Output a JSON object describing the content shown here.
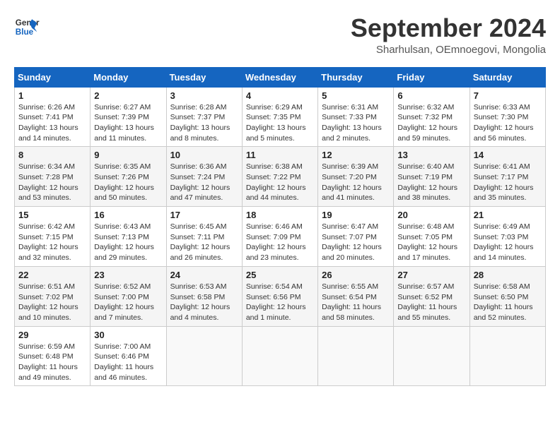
{
  "header": {
    "logo_line1": "General",
    "logo_line2": "Blue",
    "month": "September 2024",
    "location": "Sharhulsan, OEmnoegovi, Mongolia"
  },
  "weekdays": [
    "Sunday",
    "Monday",
    "Tuesday",
    "Wednesday",
    "Thursday",
    "Friday",
    "Saturday"
  ],
  "weeks": [
    [
      {
        "day": "1",
        "info": "Sunrise: 6:26 AM\nSunset: 7:41 PM\nDaylight: 13 hours\nand 14 minutes."
      },
      {
        "day": "2",
        "info": "Sunrise: 6:27 AM\nSunset: 7:39 PM\nDaylight: 13 hours\nand 11 minutes."
      },
      {
        "day": "3",
        "info": "Sunrise: 6:28 AM\nSunset: 7:37 PM\nDaylight: 13 hours\nand 8 minutes."
      },
      {
        "day": "4",
        "info": "Sunrise: 6:29 AM\nSunset: 7:35 PM\nDaylight: 13 hours\nand 5 minutes."
      },
      {
        "day": "5",
        "info": "Sunrise: 6:31 AM\nSunset: 7:33 PM\nDaylight: 13 hours\nand 2 minutes."
      },
      {
        "day": "6",
        "info": "Sunrise: 6:32 AM\nSunset: 7:32 PM\nDaylight: 12 hours\nand 59 minutes."
      },
      {
        "day": "7",
        "info": "Sunrise: 6:33 AM\nSunset: 7:30 PM\nDaylight: 12 hours\nand 56 minutes."
      }
    ],
    [
      {
        "day": "8",
        "info": "Sunrise: 6:34 AM\nSunset: 7:28 PM\nDaylight: 12 hours\nand 53 minutes."
      },
      {
        "day": "9",
        "info": "Sunrise: 6:35 AM\nSunset: 7:26 PM\nDaylight: 12 hours\nand 50 minutes."
      },
      {
        "day": "10",
        "info": "Sunrise: 6:36 AM\nSunset: 7:24 PM\nDaylight: 12 hours\nand 47 minutes."
      },
      {
        "day": "11",
        "info": "Sunrise: 6:38 AM\nSunset: 7:22 PM\nDaylight: 12 hours\nand 44 minutes."
      },
      {
        "day": "12",
        "info": "Sunrise: 6:39 AM\nSunset: 7:20 PM\nDaylight: 12 hours\nand 41 minutes."
      },
      {
        "day": "13",
        "info": "Sunrise: 6:40 AM\nSunset: 7:19 PM\nDaylight: 12 hours\nand 38 minutes."
      },
      {
        "day": "14",
        "info": "Sunrise: 6:41 AM\nSunset: 7:17 PM\nDaylight: 12 hours\nand 35 minutes."
      }
    ],
    [
      {
        "day": "15",
        "info": "Sunrise: 6:42 AM\nSunset: 7:15 PM\nDaylight: 12 hours\nand 32 minutes."
      },
      {
        "day": "16",
        "info": "Sunrise: 6:43 AM\nSunset: 7:13 PM\nDaylight: 12 hours\nand 29 minutes."
      },
      {
        "day": "17",
        "info": "Sunrise: 6:45 AM\nSunset: 7:11 PM\nDaylight: 12 hours\nand 26 minutes."
      },
      {
        "day": "18",
        "info": "Sunrise: 6:46 AM\nSunset: 7:09 PM\nDaylight: 12 hours\nand 23 minutes."
      },
      {
        "day": "19",
        "info": "Sunrise: 6:47 AM\nSunset: 7:07 PM\nDaylight: 12 hours\nand 20 minutes."
      },
      {
        "day": "20",
        "info": "Sunrise: 6:48 AM\nSunset: 7:05 PM\nDaylight: 12 hours\nand 17 minutes."
      },
      {
        "day": "21",
        "info": "Sunrise: 6:49 AM\nSunset: 7:03 PM\nDaylight: 12 hours\nand 14 minutes."
      }
    ],
    [
      {
        "day": "22",
        "info": "Sunrise: 6:51 AM\nSunset: 7:02 PM\nDaylight: 12 hours\nand 10 minutes."
      },
      {
        "day": "23",
        "info": "Sunrise: 6:52 AM\nSunset: 7:00 PM\nDaylight: 12 hours\nand 7 minutes."
      },
      {
        "day": "24",
        "info": "Sunrise: 6:53 AM\nSunset: 6:58 PM\nDaylight: 12 hours\nand 4 minutes."
      },
      {
        "day": "25",
        "info": "Sunrise: 6:54 AM\nSunset: 6:56 PM\nDaylight: 12 hours\nand 1 minute."
      },
      {
        "day": "26",
        "info": "Sunrise: 6:55 AM\nSunset: 6:54 PM\nDaylight: 11 hours\nand 58 minutes."
      },
      {
        "day": "27",
        "info": "Sunrise: 6:57 AM\nSunset: 6:52 PM\nDaylight: 11 hours\nand 55 minutes."
      },
      {
        "day": "28",
        "info": "Sunrise: 6:58 AM\nSunset: 6:50 PM\nDaylight: 11 hours\nand 52 minutes."
      }
    ],
    [
      {
        "day": "29",
        "info": "Sunrise: 6:59 AM\nSunset: 6:48 PM\nDaylight: 11 hours\nand 49 minutes."
      },
      {
        "day": "30",
        "info": "Sunrise: 7:00 AM\nSunset: 6:46 PM\nDaylight: 11 hours\nand 46 minutes."
      },
      {
        "day": "",
        "info": ""
      },
      {
        "day": "",
        "info": ""
      },
      {
        "day": "",
        "info": ""
      },
      {
        "day": "",
        "info": ""
      },
      {
        "day": "",
        "info": ""
      }
    ]
  ]
}
